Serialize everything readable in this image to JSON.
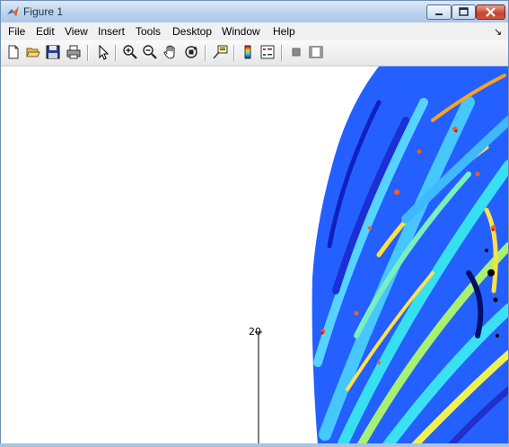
{
  "window": {
    "title": "Figure 1"
  },
  "menu": [
    "File",
    "Edit",
    "View",
    "Insert",
    "Tools",
    "Desktop",
    "Window",
    "Help"
  ],
  "toolbar": {
    "buttons": [
      "new-figure",
      "open-file",
      "save",
      "print",
      "edit-plot",
      "zoom-in",
      "zoom-out",
      "pan",
      "rotate-3d",
      "data-cursor",
      "insert-colorbar",
      "insert-legend",
      "hide-plot-tools",
      "show-plot-tools"
    ]
  },
  "plot": {
    "tick_label": "20",
    "colormap": "jet"
  }
}
